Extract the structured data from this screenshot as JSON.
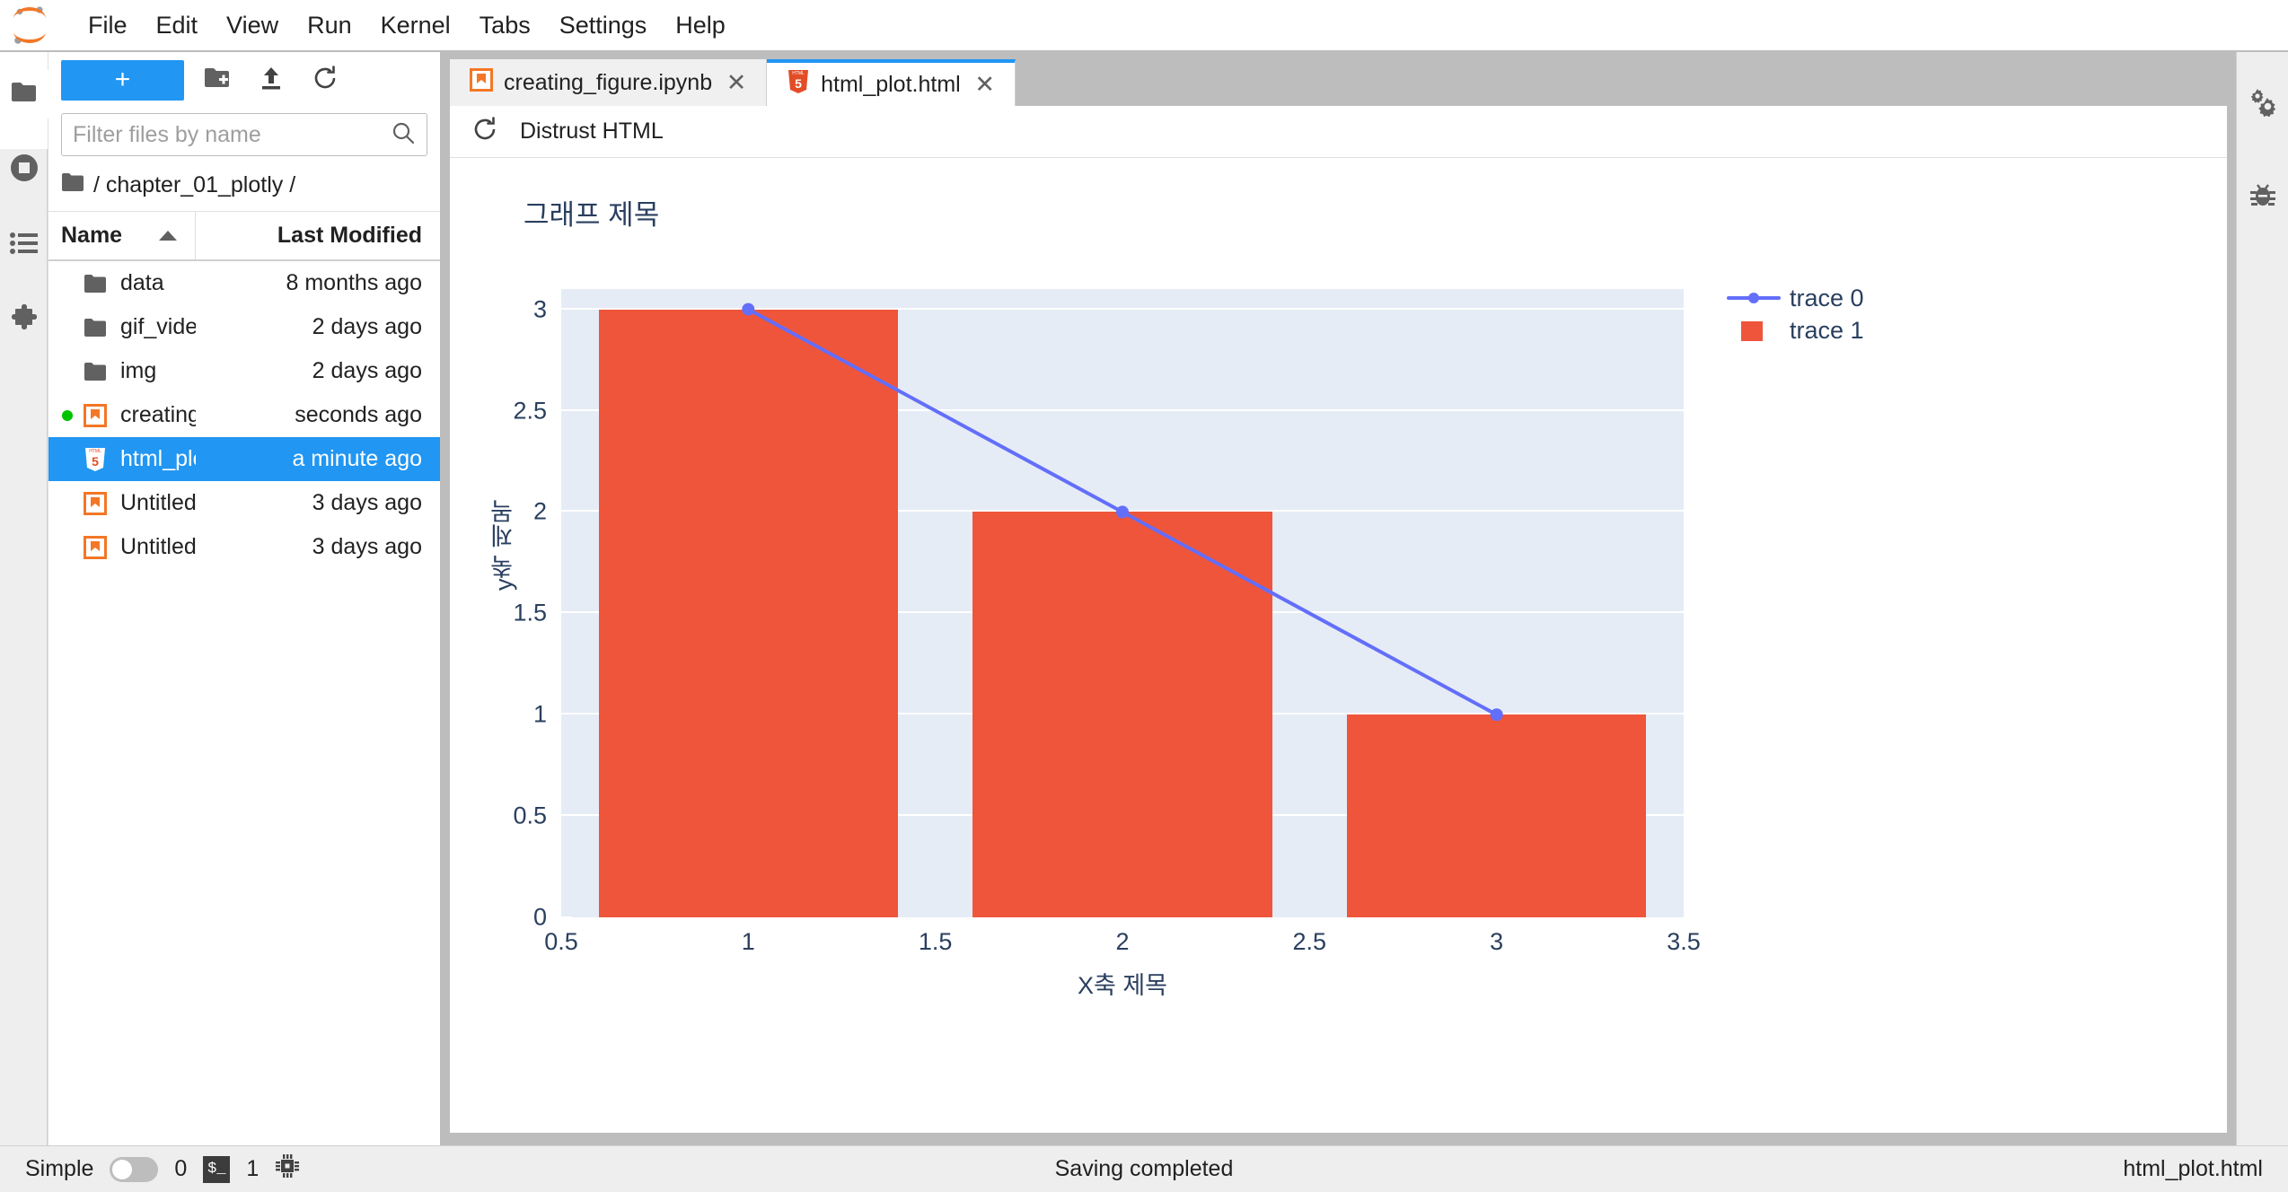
{
  "app": {
    "logo_name": "jupyter-logo"
  },
  "menubar": {
    "items": [
      {
        "label": "File",
        "name": "menu-file"
      },
      {
        "label": "Edit",
        "name": "menu-edit"
      },
      {
        "label": "View",
        "name": "menu-view"
      },
      {
        "label": "Run",
        "name": "menu-run"
      },
      {
        "label": "Kernel",
        "name": "menu-kernel"
      },
      {
        "label": "Tabs",
        "name": "menu-tabs"
      },
      {
        "label": "Settings",
        "name": "menu-settings"
      },
      {
        "label": "Help",
        "name": "menu-help"
      }
    ]
  },
  "left_rail": {
    "items": [
      {
        "icon": "folder-icon",
        "name": "sidebar-item-file-browser",
        "selected": true
      },
      {
        "icon": "running-terminals-icon",
        "name": "sidebar-item-running"
      },
      {
        "icon": "commands-list-icon",
        "name": "sidebar-item-commands"
      },
      {
        "icon": "puzzle-piece-icon",
        "name": "sidebar-item-extensions"
      }
    ]
  },
  "right_rail": {
    "items": [
      {
        "icon": "gears-icon",
        "name": "sidebar-item-property-inspector"
      },
      {
        "icon": "bug-icon",
        "name": "sidebar-item-debugger"
      }
    ]
  },
  "filebrowser": {
    "toolbar": {
      "new_launcher_label": "+",
      "new_folder_icon": "new-folder-icon",
      "upload_icon": "upload-icon",
      "refresh_icon": "refresh-icon"
    },
    "filter": {
      "placeholder": "Filter files by name",
      "value": "",
      "search_icon": "search-icon"
    },
    "breadcrumb": {
      "icon": "folder-icon",
      "path": "/ chapter_01_plotly /"
    },
    "columns": {
      "name": "Name",
      "last_modified": "Last Modified"
    },
    "sort": {
      "column": "Name",
      "direction": "asc"
    },
    "rows": [
      {
        "name": "data",
        "modified": "8 months ago",
        "type": "folder",
        "icon": "folder-icon",
        "selected": false,
        "dirty": false
      },
      {
        "name": "gif_video",
        "modified": "2 days ago",
        "type": "folder",
        "icon": "folder-icon",
        "selected": false,
        "dirty": false
      },
      {
        "name": "img",
        "modified": "2 days ago",
        "type": "folder",
        "icon": "folder-icon",
        "selected": false,
        "dirty": false
      },
      {
        "name": "creating_figure.ipynb",
        "modified": "seconds ago",
        "type": "notebook",
        "icon": "notebook-icon",
        "selected": false,
        "dirty": true
      },
      {
        "name": "html_plot.html",
        "modified": "a minute ago",
        "type": "html",
        "icon": "html5-icon",
        "selected": true,
        "dirty": false
      },
      {
        "name": "Untitled.ipynb",
        "modified": "3 days ago",
        "type": "notebook",
        "icon": "notebook-icon",
        "selected": false,
        "dirty": false
      },
      {
        "name": "Untitled.md",
        "modified": "3 days ago",
        "type": "markdown",
        "icon": "notebook-icon",
        "selected": false,
        "dirty": false
      }
    ]
  },
  "dock": {
    "tabs": [
      {
        "label": "creating_figure.ipynb",
        "icon": "notebook-icon",
        "close": "✕",
        "active": false
      },
      {
        "label": "html_plot.html",
        "icon": "html5-icon",
        "close": "✕",
        "active": true
      }
    ],
    "doc_toolbar": {
      "refresh_icon": "refresh-icon",
      "trust_label": "Distrust HTML"
    }
  },
  "chart_data": {
    "type": "bar",
    "title": "그래프 제목",
    "xlabel": "X축 제목",
    "ylabel": "y축 제목",
    "x": [
      1,
      2,
      3
    ],
    "xlim": [
      0.5,
      3.5
    ],
    "ylim": [
      0,
      3.1
    ],
    "xticks": [
      "0.5",
      "1",
      "1.5",
      "2",
      "2.5",
      "3",
      "3.5"
    ],
    "xtick_values": [
      0.5,
      1,
      1.5,
      2,
      2.5,
      3,
      3.5
    ],
    "yticks": [
      "0",
      "0.5",
      "1",
      "1.5",
      "2",
      "2.5",
      "3"
    ],
    "ytick_values": [
      0,
      0.5,
      1,
      1.5,
      2,
      2.5,
      3
    ],
    "grid": true,
    "legend_position": "right",
    "plot_bgcolor": "#E5ECF6",
    "paper_bgcolor": "#FFFFFF",
    "font_color": "#2A3F5F",
    "series": [
      {
        "name": "trace 0",
        "type": "line",
        "mode": "lines+markers",
        "color": "#636EFA",
        "x": [
          1,
          2,
          3
        ],
        "values": [
          3,
          2,
          1
        ]
      },
      {
        "name": "trace 1",
        "type": "bar",
        "color": "#EF553B",
        "x": [
          1,
          2,
          3
        ],
        "values": [
          3,
          2,
          1
        ]
      }
    ]
  },
  "statusbar": {
    "simple_label": "Simple",
    "simple_on": false,
    "kernel_count": "0",
    "terminal_glyph": "$_",
    "terminal_count": "1",
    "cpu_icon": "cpu-icon",
    "message": "Saving completed",
    "current_file": "html_plot.html"
  }
}
